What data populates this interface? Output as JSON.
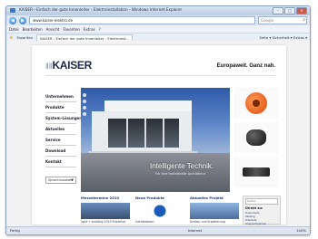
{
  "browser": {
    "window_title": "KAISER - Einfach der gute Innenleiter - Elektroinstallation - Windows Internet Explorer",
    "url": "www.kaiser-elektro.de",
    "search_placeholder": "Google",
    "menu": [
      "Datei",
      "Bearbeiten",
      "Ansicht",
      "Favoriten",
      "Extras",
      "?"
    ],
    "tab_label": "KAISER - Einfach der gute Innenleiter - Elektroinst...",
    "favorites_label": "Favoriten",
    "tools_right": "Seite ▾  Sicherheit ▾  Extras ▾",
    "status": {
      "left": "Fertig",
      "zone": "Internet",
      "zoom": "100%"
    }
  },
  "site": {
    "logo_prefix": "‖‖",
    "logo": "KAISER",
    "tagline": "Europaweit. Ganz nah.",
    "nav": [
      "Unternehmen",
      "Produkte",
      "System-Lösungen",
      "Aktuelles",
      "Service",
      "Download",
      "Kontakt"
    ],
    "language": "Sprachauswahl",
    "hero": {
      "headline": "Intelligente Technik.",
      "subline": "Für Ihre individuelle Architektur"
    },
    "cards": [
      {
        "heading": "Messetermine 2010",
        "caption": "light + building 2010 Frankfurt"
      },
      {
        "heading": "Neue Produkte",
        "caption": "Gerätedosen"
      },
      {
        "heading": "Aktuelles Projekt",
        "caption": "Umbau und Erweiterung"
      }
    ],
    "quick": {
      "search": "Suche",
      "title": "Direkt zu:",
      "links": [
        "Downloads",
        "Katalog",
        "Preisliste",
        "Ansprechpartner"
      ]
    }
  },
  "colors": {
    "accent": "#1b3a70",
    "hero_sky": "#2f5aa8",
    "product_orange": "#e0621a"
  }
}
